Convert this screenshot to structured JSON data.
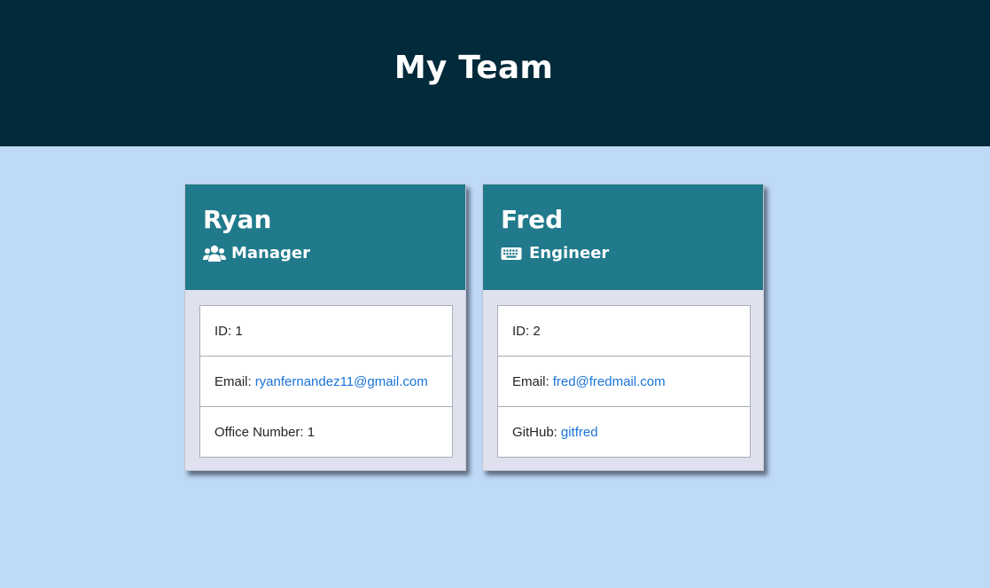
{
  "header": {
    "title": "My Team"
  },
  "employees": [
    {
      "name": "Ryan",
      "role": "Manager",
      "role_icon": "users-icon",
      "id_label": "ID: 1",
      "email_label": "Email:",
      "email": "ryanfernandez11@gmail.com",
      "extra_label": "Office Number: 1",
      "extra_link": null
    },
    {
      "name": "Fred",
      "role": "Engineer",
      "role_icon": "keyboard-icon",
      "id_label": "ID: 2",
      "email_label": "Email:",
      "email": "fred@fredmail.com",
      "extra_label": "GitHub:",
      "extra_link": "gitfred"
    }
  ],
  "colors": {
    "header_bg": "#012a3a",
    "page_bg": "#bfdaf7",
    "card_head_bg": "#207a8b",
    "card_body_bg": "#dfe2ee",
    "link": "#1a73d9"
  }
}
